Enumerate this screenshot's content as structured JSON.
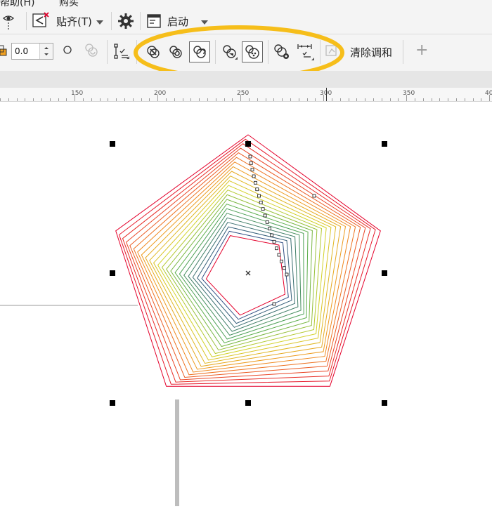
{
  "menu": {
    "help": "帮助(H)",
    "buy": "购买"
  },
  "toolbar1": {
    "snap_label": "贴齐(T)",
    "launch_label": "启动"
  },
  "toolbar2": {
    "angle_value": "0.0",
    "clear_blend_label": "清除调和",
    "add_label": "+"
  },
  "ruler": {
    "marks": [
      "150",
      "200",
      "250",
      "300",
      "350",
      "40"
    ]
  },
  "icons": {
    "eye": "eye-icon",
    "snap": "snap-icon",
    "gear": "gear-icon",
    "launch": "window-icon",
    "blend_direct": "blend-direct-icon",
    "blend_clockwise": "blend-clockwise-icon",
    "blend_counterclockwise": "blend-counterclockwise-icon",
    "object_color": "object-color-icon",
    "acceleration": "acceleration-icon",
    "blend_options": "blend-options-icon",
    "path_properties": "path-properties-icon"
  },
  "colors": {
    "highlight": "#F6BE1A",
    "blend_start": "#E4002B",
    "blend_end": "#2A3E8C"
  }
}
